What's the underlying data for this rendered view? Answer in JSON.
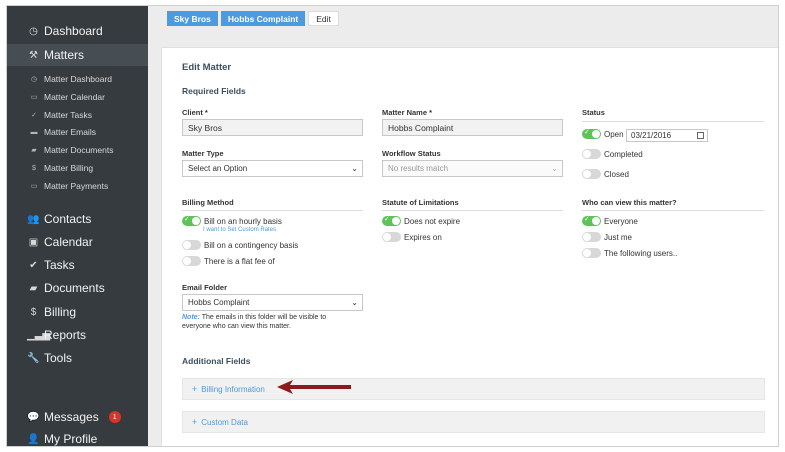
{
  "sidebar": {
    "dashboard": "Dashboard",
    "matters": "Matters",
    "sub": [
      "Matter Dashboard",
      "Matter Calendar",
      "Matter Tasks",
      "Matter Emails",
      "Matter Documents",
      "Matter Billing",
      "Matter Payments"
    ],
    "contacts": "Contacts",
    "calendar": "Calendar",
    "tasks": "Tasks",
    "documents": "Documents",
    "billing": "Billing",
    "reports": "Reports",
    "tools": "Tools",
    "messages": "Messages",
    "messages_badge": "1",
    "profile": "My Profile"
  },
  "breadcrumb": {
    "client": "Sky Bros",
    "matter": "Hobbs Complaint",
    "current": "Edit"
  },
  "form": {
    "title": "Edit Matter",
    "required_title": "Required Fields",
    "client_label": "Client *",
    "client_value": "Sky Bros",
    "matter_name_label": "Matter Name *",
    "matter_name_value": "Hobbs Complaint",
    "status_label": "Status",
    "status_open": "Open",
    "status_date": "03/21/2016",
    "status_completed": "Completed",
    "status_closed": "Closed",
    "matter_type_label": "Matter Type",
    "matter_type_value": "Select an Option",
    "workflow_label": "Workflow Status",
    "workflow_value": "No results match",
    "billing_label": "Billing Method",
    "billing_hourly": "Bill on an hourly basis",
    "billing_custom_rates": "I want to Set Custom Rates",
    "billing_contingency": "Bill on a contingency basis",
    "billing_flat": "There is a flat fee of",
    "sol_label": "Statute of Limitations",
    "sol_not_expire": "Does not expire",
    "sol_expires_on": "Expires on",
    "who_label": "Who can view this matter?",
    "who_everyone": "Everyone",
    "who_just_me": "Just me",
    "who_following": "The following users..",
    "email_folder_label": "Email Folder",
    "email_folder_value": "Hobbs Complaint",
    "note_prefix": "Note:",
    "note_text1": " The emails in this folder will be visible to",
    "note_text2": "everyone who can view this matter.",
    "additional_title": "Additional Fields",
    "billing_info": "Billing Information",
    "custom_data": "Custom Data"
  },
  "colors": {
    "accent": "#4e9adf",
    "sidebar_bg": "#353b3f",
    "toggle_on": "#5fc35a",
    "arrow": "#8b1a1a"
  }
}
